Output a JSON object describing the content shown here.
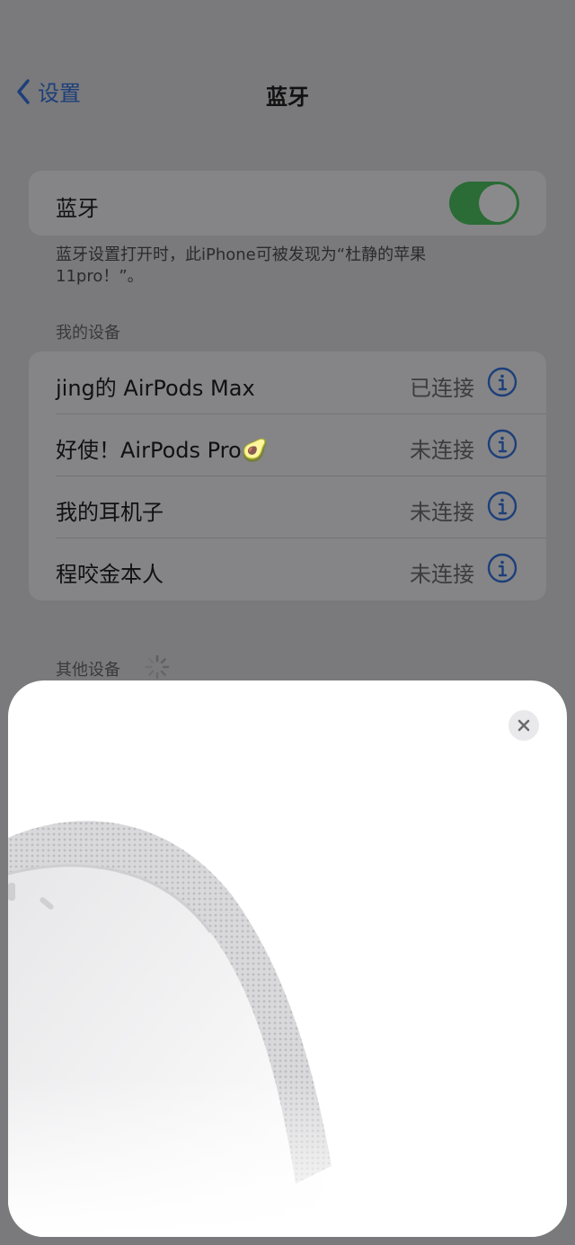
{
  "nav": {
    "back_label": "设置",
    "title": "蓝牙"
  },
  "bluetooth": {
    "label": "蓝牙",
    "enabled": true,
    "hint": "蓝牙设置打开时，此iPhone可被发现为“杜静的苹果11pro！”。"
  },
  "my_devices": {
    "header": "我的设备",
    "items": [
      {
        "name": "jing的 AirPods Max",
        "status": "已连接"
      },
      {
        "name": "好使！AirPods Pro🥑",
        "status": "未连接"
      },
      {
        "name": "我的耳机子",
        "status": "未连接"
      },
      {
        "name": "程咬金本人",
        "status": "未连接"
      }
    ]
  },
  "other_devices": {
    "header": "其他设备"
  },
  "sheet": {
    "image_icon": "airpods-max-headband-image",
    "close_icon": "close-icon"
  },
  "colors": {
    "accent": "#1d3f7a",
    "toggle_on": "#2a6b36",
    "sheet_bg": "#ffffff",
    "dim_bg": "#7a7a7c"
  }
}
